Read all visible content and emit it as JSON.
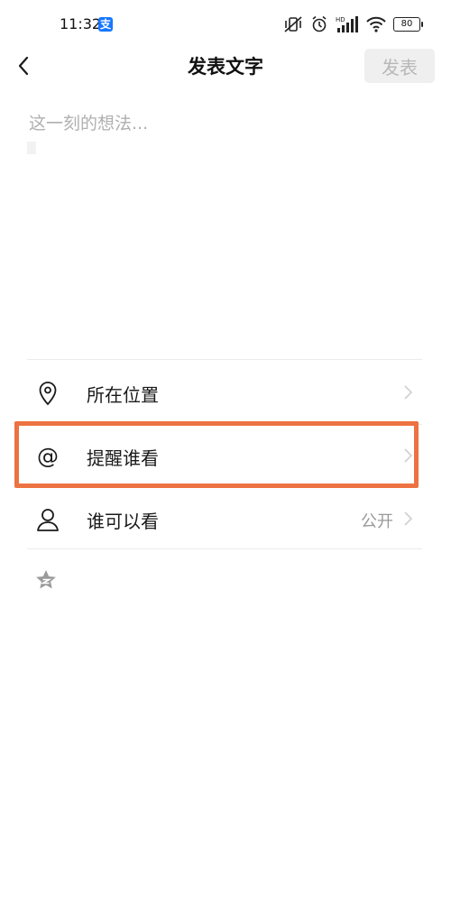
{
  "status_bar": {
    "time": "11:32",
    "app_badge": "支",
    "network_label": "HD",
    "battery": "80"
  },
  "nav": {
    "title": "发表文字",
    "publish_label": "发表"
  },
  "composer": {
    "placeholder": "这一刻的想法..."
  },
  "options": [
    {
      "label": "所在位置",
      "icon": "location-pin-icon"
    },
    {
      "label": "提醒谁看",
      "icon": "at-sign-icon"
    },
    {
      "label": "谁可以看",
      "value": "公开",
      "icon": "person-icon"
    }
  ],
  "highlight_color": "#ec7341",
  "accent_icon": "emoji-star-icon"
}
